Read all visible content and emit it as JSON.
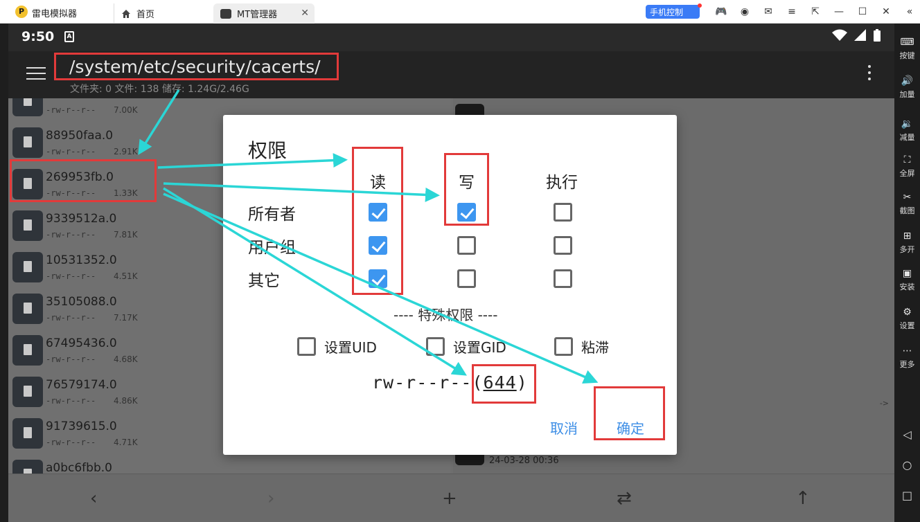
{
  "emulator": {
    "app_name": "雷电模拟器",
    "logo_text": "P",
    "tabs": [
      {
        "label": "首页",
        "icon": "home-icon"
      },
      {
        "label": "MT管理器",
        "icon": "mt-app-icon",
        "close": "✕"
      }
    ],
    "phone_control_label": "手机控制",
    "sidebar": [
      {
        "label": "按键",
        "icon": "keyboard-icon",
        "glyph": "⌨"
      },
      {
        "label": "加量",
        "icon": "volume-up-icon",
        "glyph": "🔊"
      },
      {
        "label": "减量",
        "icon": "volume-down-icon",
        "glyph": "🔉"
      },
      {
        "label": "全屏",
        "icon": "fullscreen-icon",
        "glyph": "⛶"
      },
      {
        "label": "截图",
        "icon": "scissors-icon",
        "glyph": "✂"
      },
      {
        "label": "多开",
        "icon": "multi-instance-icon",
        "glyph": "⊞"
      },
      {
        "label": "安装",
        "icon": "apk-install-icon",
        "glyph": "▣"
      },
      {
        "label": "设置",
        "icon": "settings-icon",
        "glyph": "⚙"
      },
      {
        "label": "更多",
        "icon": "more-icon",
        "glyph": "⋯"
      }
    ]
  },
  "status_bar": {
    "time": "9:50",
    "badge": "A"
  },
  "appbar": {
    "path": "/system/etc/security/cacerts/",
    "summary": "文件夹: 0  文件: 138  储存: 1.24G/2.46G"
  },
  "files": [
    {
      "name": "",
      "perm": "-rw-r--r--",
      "size": "7.00K"
    },
    {
      "name": "88950faa.0",
      "perm": "-rw-r--r--",
      "size": "2.91K"
    },
    {
      "name": "269953fb.0",
      "perm": "-rw-r--r--",
      "size": "1.33K"
    },
    {
      "name": "9339512a.0",
      "perm": "-rw-r--r--",
      "size": "7.81K"
    },
    {
      "name": "10531352.0",
      "perm": "-rw-r--r--",
      "size": "4.51K"
    },
    {
      "name": "35105088.0",
      "perm": "-rw-r--r--",
      "size": "7.17K"
    },
    {
      "name": "67495436.0",
      "perm": "-rw-r--r--",
      "size": "4.68K"
    },
    {
      "name": "76579174.0",
      "perm": "-rw-r--r--",
      "size": "4.86K"
    },
    {
      "name": "91739615.0",
      "perm": "-rw-r--r--",
      "size": "4.71K"
    },
    {
      "name": "a0bc6fbb.0",
      "perm": "",
      "size": ""
    }
  ],
  "right_pane": {
    "timestamp": "24-03-28 00:36",
    "arrow": "->"
  },
  "dialog": {
    "title": "权限",
    "columns": [
      "读",
      "写",
      "执行"
    ],
    "rows": [
      {
        "label": "所有者",
        "read": true,
        "write": true,
        "exec": false
      },
      {
        "label": "用户组",
        "read": true,
        "write": false,
        "exec": false
      },
      {
        "label": "其它",
        "read": true,
        "write": false,
        "exec": false
      }
    ],
    "special_header": "---- 特殊权限 ----",
    "special": [
      {
        "label": "设置UID",
        "checked": false
      },
      {
        "label": "设置GID",
        "checked": false
      },
      {
        "label": "粘滞",
        "checked": false
      }
    ],
    "perm_string": "rw-r--r--",
    "perm_open": "(",
    "perm_octal": "644",
    "perm_close": ")",
    "cancel_label": "取消",
    "ok_label": "确定"
  },
  "colors": {
    "annotation_red": "#e23a3a",
    "annotation_cyan": "#2bd6d6",
    "checkbox_blue": "#3d96f0",
    "button_blue": "#3d8ee6"
  }
}
